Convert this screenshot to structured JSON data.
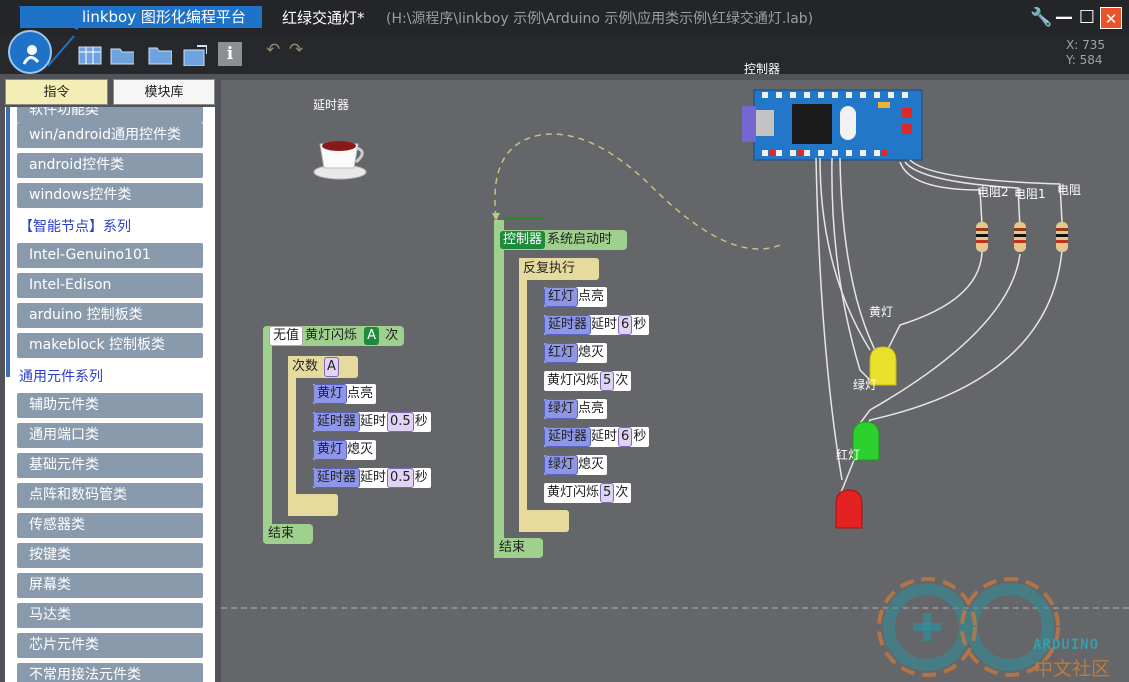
{
  "title_bar": {
    "app_title": "linkboy 图形化编程平台",
    "doc_title": "红绿交通灯*",
    "doc_path": "(H:\\源程序\\linkboy 示例\\Arduino 示例\\应用类示例\\红绿交通灯.lab)",
    "settings_glyph": "🔧",
    "minimize_glyph": "—",
    "maximize_glyph": "☐",
    "close_glyph": "✕"
  },
  "toolbar": {
    "undo_glyph": "↶",
    "redo_glyph": "↷",
    "info_glyph": "i"
  },
  "coords": {
    "x": "X: 735",
    "y": "Y: 584"
  },
  "left_panel": {
    "tabs": [
      "指令",
      "模块库"
    ],
    "categories": [
      {
        "label": "软件功能类",
        "type": "item"
      },
      {
        "label": "win/android通用控件类",
        "type": "item"
      },
      {
        "label": "android控件类",
        "type": "item"
      },
      {
        "label": "windows控件类",
        "type": "item"
      },
      {
        "label": "【智能节点】系列",
        "type": "header"
      },
      {
        "label": "Intel-Genuino101",
        "type": "item"
      },
      {
        "label": "Intel-Edison",
        "type": "item"
      },
      {
        "label": "arduino 控制板类",
        "type": "item"
      },
      {
        "label": "makeblock 控制板类",
        "type": "item"
      },
      {
        "label": "通用元件系列",
        "type": "header"
      },
      {
        "label": "辅助元件类",
        "type": "item"
      },
      {
        "label": "通用端口类",
        "type": "item"
      },
      {
        "label": "基础元件类",
        "type": "item"
      },
      {
        "label": "点阵和数码管类",
        "type": "item"
      },
      {
        "label": "传感器类",
        "type": "item"
      },
      {
        "label": "按键类",
        "type": "item"
      },
      {
        "label": "屏幕类",
        "type": "item"
      },
      {
        "label": "马达类",
        "type": "item"
      },
      {
        "label": "芯片元件类",
        "type": "item"
      },
      {
        "label": "不常用接法元件类",
        "type": "item"
      }
    ]
  },
  "canvas": {
    "labels": {
      "timer": "延时器",
      "controller": "控制器",
      "resistor2": "电阻2",
      "resistor1": "电阻1",
      "resistor": "电阻",
      "yellow_light": "黄灯",
      "green_light": "绿灯",
      "red_light": "红灯"
    },
    "function_block": {
      "type_tag": "无值",
      "name": "黄灯闪烁",
      "param": "A",
      "param_suffix": "次",
      "loop_label": "次数",
      "loop_param": "A",
      "statements": [
        {
          "target": "黄灯",
          "action": "点亮"
        },
        {
          "target": "延时器",
          "action": "延时",
          "value": "0.5",
          "unit": "秒"
        },
        {
          "target": "黄灯",
          "action": "熄灭"
        },
        {
          "target": "延时器",
          "action": "延时",
          "value": "0.5",
          "unit": "秒"
        }
      ],
      "end_label": "结束"
    },
    "event_block": {
      "target": "控制器",
      "event": "系统启动时",
      "loop_label": "反复执行",
      "statements": [
        {
          "target": "红灯",
          "action": "点亮"
        },
        {
          "target": "延时器",
          "action": "延时",
          "value": "6",
          "unit": "秒"
        },
        {
          "target": "红灯",
          "action": "熄灭"
        },
        {
          "target": "",
          "action": "黄灯闪烁",
          "value": "5",
          "unit": "次"
        },
        {
          "target": "绿灯",
          "action": "点亮"
        },
        {
          "target": "延时器",
          "action": "延时",
          "value": "6",
          "unit": "秒"
        },
        {
          "target": "绿灯",
          "action": "熄灭"
        },
        {
          "target": "",
          "action": "黄灯闪烁",
          "value": "5",
          "unit": "次"
        }
      ],
      "end_label": "结束"
    },
    "watermark": {
      "line1": "ARDUINO",
      "line2": "中文社区"
    }
  }
}
